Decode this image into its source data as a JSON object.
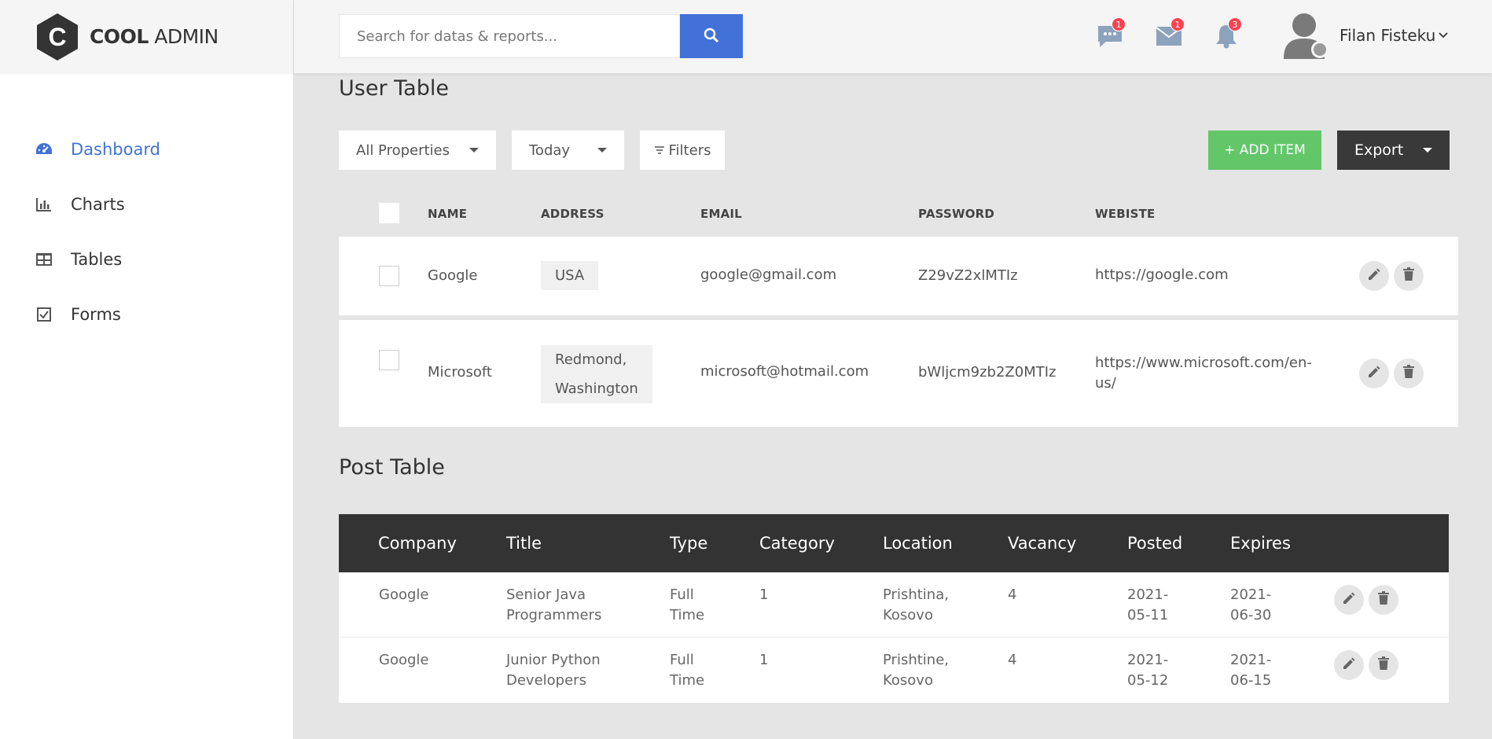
{
  "brand": {
    "bold": "COOL",
    "light": "ADMIN"
  },
  "sidebar": {
    "items": [
      {
        "label": "Dashboard",
        "icon": "gauge-icon",
        "active": true
      },
      {
        "label": "Charts",
        "icon": "bar-chart-icon"
      },
      {
        "label": "Tables",
        "icon": "table-icon"
      },
      {
        "label": "Forms",
        "icon": "checkbox-icon"
      }
    ]
  },
  "header": {
    "search_placeholder": "Search for datas & reports...",
    "notifications": {
      "chat": "1",
      "mail": "1",
      "bell": "3"
    },
    "user_name": "Filan Fisteku"
  },
  "user_table": {
    "title": "User Table",
    "filters": {
      "properties": "All Properties",
      "date": "Today",
      "filters_label": "Filters"
    },
    "add_label": "+ ADD ITEM",
    "export_label": "Export",
    "columns": {
      "name": "NAME",
      "address": "ADDRESS",
      "email": "EMAIL",
      "password": "PASSWORD",
      "website": "WEBISTE"
    },
    "rows": [
      {
        "name": "Google",
        "address_1": "USA",
        "address_2": "",
        "email": "google@gmail.com",
        "password": "Z29vZ2xlMTIz",
        "website_1": "https://google.com",
        "website_2": ""
      },
      {
        "name": "Microsoft",
        "address_1": "Redmond,",
        "address_2": "Washington",
        "email": "microsoft@hotmail.com",
        "password": "bWljcm9zb2Z0MTIz",
        "website_1": "https://www.microsoft.com/en-",
        "website_2": "us/"
      }
    ]
  },
  "post_table": {
    "title": "Post Table",
    "columns": {
      "company": "Company",
      "title": "Title",
      "type": "Type",
      "category": "Category",
      "location": "Location",
      "vacancy": "Vacancy",
      "posted": "Posted",
      "expires": "Expires"
    },
    "rows": [
      {
        "company": "Google",
        "title_1": "Senior Java",
        "title_2": "Programmers",
        "type_1": "Full",
        "type_2": "Time",
        "category": "1",
        "location_1": "Prishtina,",
        "location_2": "Kosovo",
        "vacancy": "4",
        "posted_1": "2021-",
        "posted_2": "05-11",
        "expires_1": "2021-",
        "expires_2": "06-30"
      },
      {
        "company": "Google",
        "title_1": "Junior Python",
        "title_2": "Developers",
        "type_1": "Full",
        "type_2": "Time",
        "category": "1",
        "location_1": "Prishtine,",
        "location_2": "Kosovo",
        "vacancy": "4",
        "posted_1": "2021-",
        "posted_2": "05-12",
        "expires_1": "2021-",
        "expires_2": "06-15"
      }
    ]
  },
  "colors": {
    "accent": "#4272d7",
    "add": "#63c76a",
    "dark": "#333333",
    "badge": "#fa4251"
  }
}
